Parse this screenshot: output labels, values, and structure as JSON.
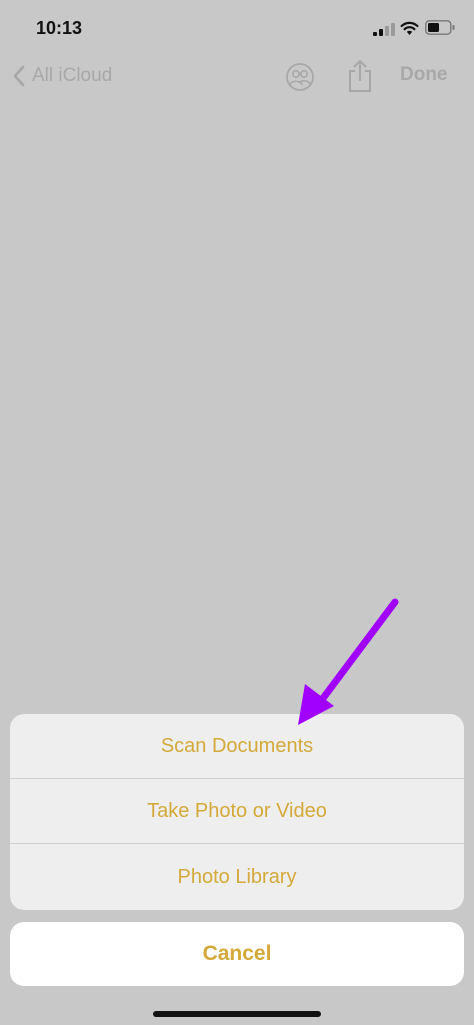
{
  "status_bar": {
    "time": "10:13"
  },
  "nav": {
    "back_label": "All iCloud",
    "done_label": "Done"
  },
  "action_sheet": {
    "items": [
      {
        "label": "Scan Documents"
      },
      {
        "label": "Take Photo or Video"
      },
      {
        "label": "Photo Library"
      }
    ],
    "cancel_label": "Cancel"
  },
  "colors": {
    "accent": "#d4a93a",
    "annotation_arrow": "#a100ff",
    "background": "#c8c8c8"
  },
  "icons": [
    "chevron-left-icon",
    "add-people-icon",
    "share-icon",
    "signal-icon",
    "wifi-icon",
    "battery-icon"
  ]
}
